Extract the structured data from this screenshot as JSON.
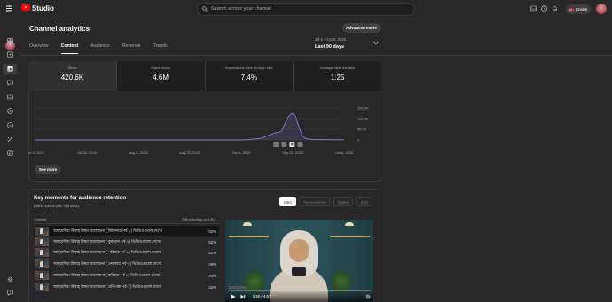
{
  "header": {
    "brand": "Studio",
    "search_placeholder": "Search across your channel",
    "create_label": "Create"
  },
  "page": {
    "title": "Channel analytics",
    "advanced_mode_label": "Advanced mode",
    "tabs": [
      "Overview",
      "Content",
      "Audience",
      "Revenue",
      "Trends"
    ],
    "active_tab": "Content",
    "date_range": {
      "sub": "Jul 9 – Oct 6, 2025",
      "label": "Last 90 days"
    }
  },
  "kpis": [
    {
      "label": "Views",
      "value": "420.6K"
    },
    {
      "label": "Impressions",
      "value": "4.6M"
    },
    {
      "label": "Impressions click-through rate",
      "value": "7.4%"
    },
    {
      "label": "Average view duration",
      "value": "1:25"
    }
  ],
  "chart_data": {
    "type": "line",
    "x_ticks": [
      "Jul 9, 2025",
      "Jul 24, 2025",
      "Aug 8, 2025",
      "Aug 23, 2025",
      "Sep 6, 2025",
      "Sep 21, 2025",
      "Oct 6, 2025"
    ],
    "y_ticks": [
      "150.0K",
      "100.0K",
      "50.0K",
      "0"
    ],
    "ylim": [
      0,
      150000
    ],
    "series": [
      {
        "color": "#7f7fdb",
        "points": [
          [
            "Jul 9",
            0
          ],
          [
            "Jul 24",
            0
          ],
          [
            "Aug 8",
            0
          ],
          [
            "Aug 23",
            0
          ],
          [
            "Sep 6",
            0
          ],
          [
            "Sep 9",
            2000
          ],
          [
            "Sep 12",
            8000
          ],
          [
            "Sep 14",
            20000
          ],
          [
            "Sep 16",
            33000
          ],
          [
            "Sep 17",
            36000
          ],
          [
            "Sep 18",
            42000
          ],
          [
            "Sep 19",
            78000
          ],
          [
            "Sep 20",
            110000
          ],
          [
            "Sep 21",
            125000
          ],
          [
            "Sep 22",
            110000
          ],
          [
            "Sep 23",
            60000
          ],
          [
            "Sep 24",
            20000
          ],
          [
            "Sep 25",
            6000
          ],
          [
            "Sep 27",
            2000
          ],
          [
            "Oct 6",
            1000
          ]
        ]
      }
    ],
    "grid": true,
    "legend": "none"
  },
  "see_more_label": "See more",
  "key_moments": {
    "title": "Key moments for audience retention",
    "subtitle": "Latest videos (last 365 days)",
    "tabs": [
      "Intro",
      "Top moments",
      "Spikes",
      "Dips"
    ],
    "active_tab": "Intro",
    "col_content": "Content",
    "col_metric": "Still watching at 0:30",
    "rows": [
      {
        "title": "আহমেদিয়া উম্মাহ বিষয় আলোচনা ( ঈমানদার পর্ব-১) ভিডিওগুলো দেখো",
        "pct": "55%"
      },
      {
        "title": "আহমেদিয়া উম্মাহ বিষয় আলোচনা ( কুরআন পর্ব-১) ভিডিওগুলো দেখো",
        "pct": "52%"
      },
      {
        "title": "আহমেদিয়া উম্মাহ বিষয় আলোচনা ( পরিবার পর্ব-১) ভিডিওগুলো দেখো",
        "pct": "51%"
      },
      {
        "title": "আহমেদিয়া উম্মাহ বিষয় আলোচনা ( নেককার পর্ব-১) ভিডিওগুলো দেখো",
        "pct": "49%"
      },
      {
        "title": "আহমেদিয়া উম্মাহ বিষয় আলোচনা ( রবিবার পর্ব-১) ভিডিওগুলো দেখো",
        "pct": "44%"
      },
      {
        "title": "আহমেদিয়া উম্মাহ বিষয় আলোচনা ( প্রতিপক্ষ পর্ব-১) ভিডিওগুলো দেখো",
        "pct": "42%"
      }
    ],
    "video": {
      "time": "0:00 / 4:57",
      "progress": 0.0
    }
  }
}
